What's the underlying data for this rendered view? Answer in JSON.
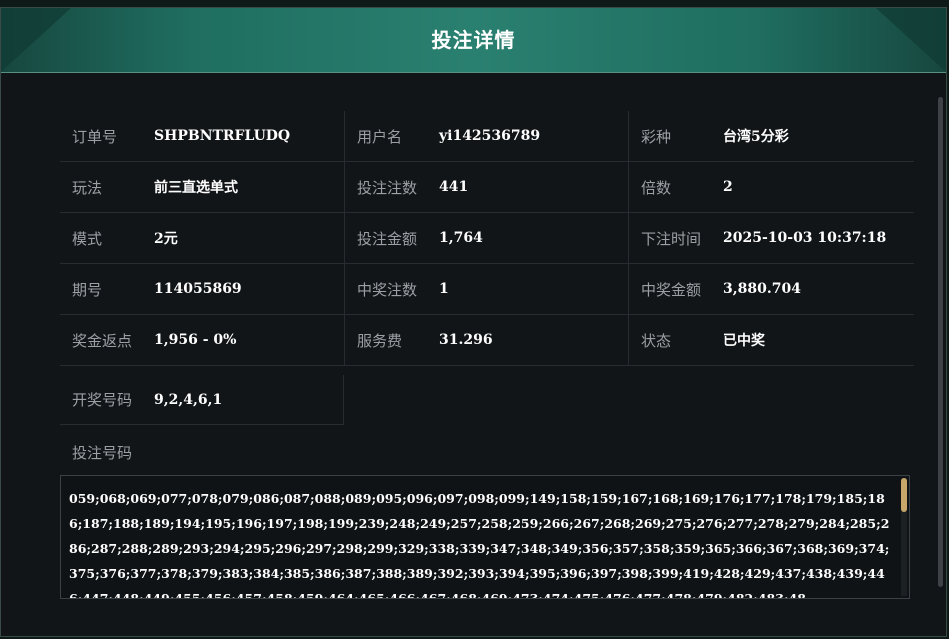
{
  "modal": {
    "title": "投注详情"
  },
  "details": [
    [
      {
        "label": "订单号",
        "value": "SHPBNTRFLUDQ"
      },
      {
        "label": "用户名",
        "value": "yi142536789"
      },
      {
        "label": "彩种",
        "value": "台湾5分彩"
      }
    ],
    [
      {
        "label": "玩法",
        "value": "前三直选单式"
      },
      {
        "label": "投注注数",
        "value": "441"
      },
      {
        "label": "倍数",
        "value": "2"
      }
    ],
    [
      {
        "label": "模式",
        "value": "2元"
      },
      {
        "label": "投注金额",
        "value": "1,764"
      },
      {
        "label": "下注时间",
        "value": "2025-10-03 10:37:18"
      }
    ],
    [
      {
        "label": "期号",
        "value": "114055869"
      },
      {
        "label": "中奖注数",
        "value": "1"
      },
      {
        "label": "中奖金额",
        "value": "3,880.704"
      }
    ],
    [
      {
        "label": "奖金返点",
        "value": "1,956 - 0%"
      },
      {
        "label": "服务费",
        "value": "31.296"
      },
      {
        "label": "状态",
        "value": "已中奖"
      }
    ]
  ],
  "draw": {
    "label": "开奖号码",
    "value": "9,2,4,6,1"
  },
  "bets": {
    "label": "投注号码",
    "numbers": "059;068;069;077;078;079;086;087;088;089;095;096;097;098;099;149;158;159;167;168;169;176;177;178;179;185;186;187;188;189;194;195;196;197;198;199;239;248;249;257;258;259;266;267;268;269;275;276;277;278;279;284;285;286;287;288;289;293;294;295;296;297;298;299;329;338;339;347;348;349;356;357;358;359;365;366;367;368;369;374;375;376;377;378;379;383;384;385;386;387;388;389;392;393;394;395;396;397;398;399;419;428;429;437;438;439;446;447;448;449;455;456;457;458;459;464;465;466;467;468;469;473;474;475;476;477;478;479;482;483;48"
  }
}
